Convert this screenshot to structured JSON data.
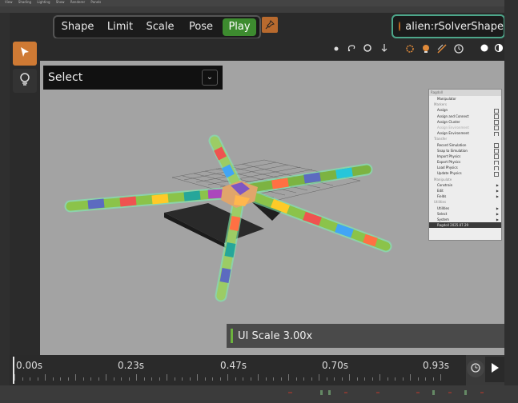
{
  "maya_menu": [
    "View",
    "Shading",
    "Lighting",
    "Show",
    "Renderer",
    "Panels"
  ],
  "mode_tabs": [
    {
      "label": "Shape",
      "active": false
    },
    {
      "label": "Limit",
      "active": false
    },
    {
      "label": "Scale",
      "active": false
    },
    {
      "label": "Pose",
      "active": false
    },
    {
      "label": "Play",
      "active": true
    }
  ],
  "solver": {
    "name": "alien:rSolverShape",
    "dot_color": "#c06a22"
  },
  "select_dropdown": {
    "label": "Select"
  },
  "context_menu": {
    "title": "Ragdoll",
    "items": [
      {
        "label": "Manipulator",
        "kind": "item"
      },
      {
        "label": "Markers",
        "kind": "section"
      },
      {
        "label": "Assign",
        "kind": "item",
        "box": true
      },
      {
        "label": "Assign and Connect",
        "kind": "item",
        "box": true
      },
      {
        "label": "Assign Cluster",
        "kind": "item",
        "box": true
      },
      {
        "label": "Assign Environment",
        "kind": "disabled",
        "box": true
      },
      {
        "label": "Assign Environment",
        "kind": "item",
        "box": true
      },
      {
        "label": "Transfer",
        "kind": "section"
      },
      {
        "label": "Record Simulation",
        "kind": "item",
        "box": true
      },
      {
        "label": "Snap to Simulation",
        "kind": "item",
        "box": true
      },
      {
        "label": "Import Physics",
        "kind": "item",
        "box": true
      },
      {
        "label": "Export Physics",
        "kind": "item",
        "box": true
      },
      {
        "label": "Load Physics",
        "kind": "item",
        "box": true
      },
      {
        "label": "Update Physics",
        "kind": "item",
        "box": true
      },
      {
        "label": "Manipulate",
        "kind": "section"
      },
      {
        "label": "Constrain",
        "kind": "item",
        "arrow": true
      },
      {
        "label": "Edit",
        "kind": "item",
        "arrow": true
      },
      {
        "label": "Fields",
        "kind": "item",
        "arrow": true
      },
      {
        "label": "Utilities",
        "kind": "section"
      },
      {
        "label": "Utilities",
        "kind": "item",
        "arrow": true
      },
      {
        "label": "Select",
        "kind": "item",
        "arrow": true
      },
      {
        "label": "System",
        "kind": "item",
        "arrow": true
      },
      {
        "label": "Ragdoll 2025.07.29",
        "kind": "highlight"
      }
    ]
  },
  "ui_scale": {
    "text": "UI Scale 3.00x",
    "accent": "#6cb33e"
  },
  "timeline": {
    "labels": [
      "0.00s",
      "0.23s",
      "0.47s",
      "0.70s",
      "0.93s"
    ]
  },
  "colors": {
    "play_active": "#3d8b2f",
    "solver_border": "#4da68a",
    "tool_active": "#cf7a34",
    "viewport_bg": "#a3a3a3"
  },
  "icons": {
    "strip": [
      "circle-dot-icon",
      "loop-icon",
      "ring-icon",
      "down-arrow-icon",
      "sun-icon",
      "bulb-icon",
      "ramp-icon",
      "clock-icon",
      "dot-icon",
      "half-circle-icon"
    ]
  }
}
